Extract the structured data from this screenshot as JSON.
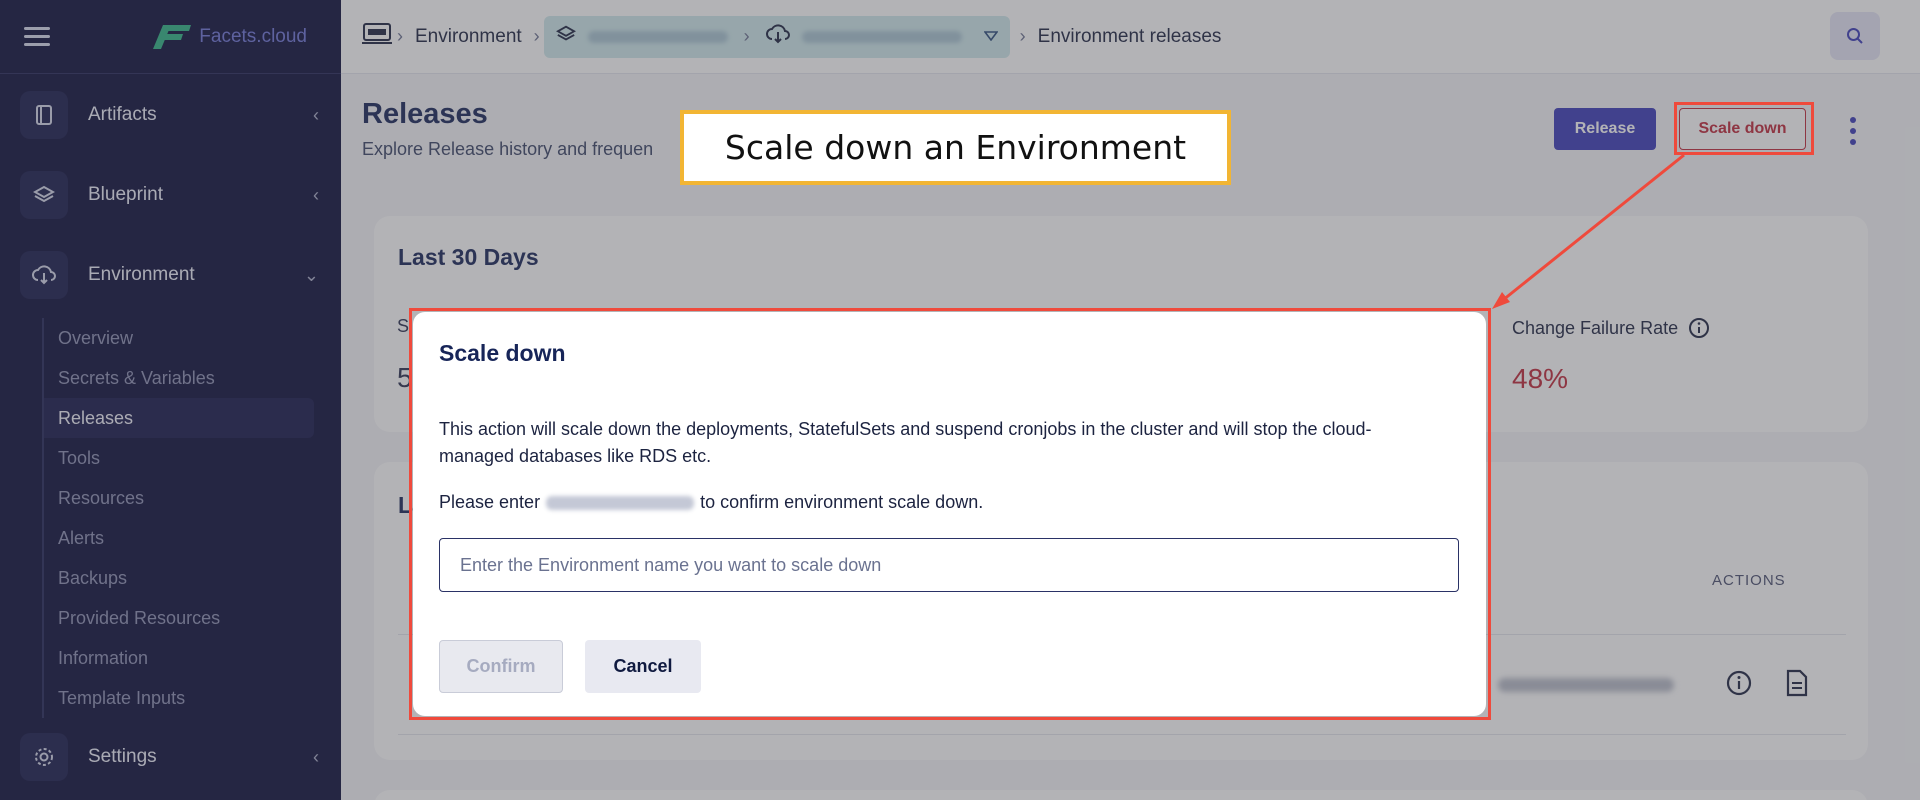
{
  "app": {
    "logo_text": "Facets.cloud"
  },
  "sidebar": {
    "items": [
      {
        "label": "Artifacts",
        "icon": "book-icon"
      },
      {
        "label": "Blueprint",
        "icon": "layers-icon"
      },
      {
        "label": "Environment",
        "icon": "cloud-download-icon"
      },
      {
        "label": "Settings",
        "icon": "gear-icon"
      }
    ],
    "environment_subitems": [
      "Overview",
      "Secrets & Variables",
      "Releases",
      "Tools",
      "Resources",
      "Alerts",
      "Backups",
      "Provided Resources",
      "Information",
      "Template Inputs"
    ],
    "active_subitem": "Releases"
  },
  "breadcrumb": {
    "environment": "Environment",
    "current": "Environment releases"
  },
  "header": {
    "title": "Releases",
    "subtitle": "Explore Release history and frequen",
    "release_button": "Release",
    "scale_down_button": "Scale down"
  },
  "stats_card": {
    "title": "Last 30 Days",
    "change_failure_rate_label": "Change Failure Rate",
    "change_failure_rate_value": "48%",
    "partial_label": "S",
    "partial_value": "5"
  },
  "releases_card": {
    "title_partial": "La",
    "actions_header": "ACTIONS"
  },
  "modal": {
    "title": "Scale down",
    "description": "This action will scale down the deployments, StatefulSets and suspend cronjobs in the cluster and will stop the cloud-managed databases like RDS etc.",
    "enter_prefix": "Please enter",
    "enter_suffix": "to confirm environment scale down.",
    "input_placeholder": "Enter the Environment name you want to scale down",
    "input_value": "",
    "confirm_button": "Confirm",
    "cancel_button": "Cancel"
  },
  "annotation": {
    "callout_text": "Scale down an Environment",
    "callout_border_color": "#f2b533",
    "highlight_color": "#ef4a3c"
  },
  "colors": {
    "sidebar_bg": "#0c0d3a",
    "primary": "#3c3cb8",
    "danger": "#c0283a"
  }
}
